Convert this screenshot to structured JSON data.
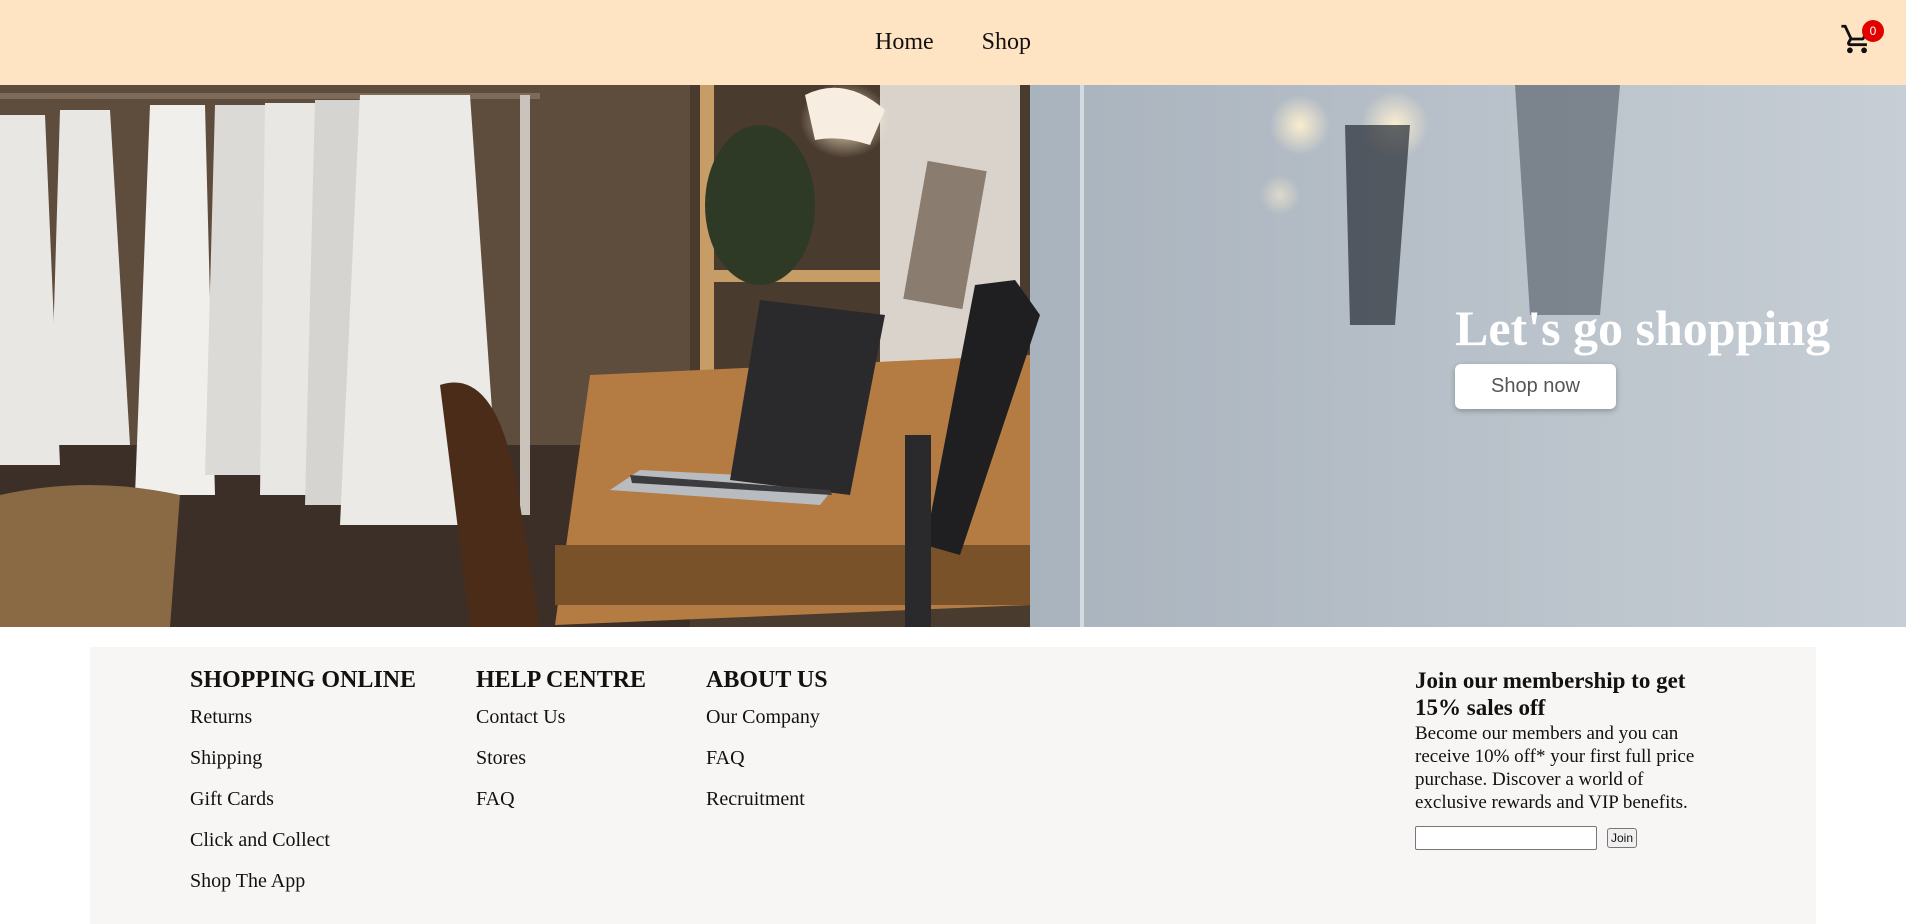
{
  "nav": {
    "links": [
      "Home",
      "Shop"
    ],
    "cart_icon": "shopping-cart-icon",
    "cart_count": "0"
  },
  "hero": {
    "title": "Let's go shopping",
    "button_label": "Shop now"
  },
  "footer": {
    "columns": [
      {
        "heading": "SHOPPING ONLINE",
        "links": [
          "Returns",
          "Shipping",
          "Gift Cards",
          "Click and Collect",
          "Shop The App"
        ]
      },
      {
        "heading": "HELP CENTRE",
        "links": [
          "Contact Us",
          "Stores",
          "FAQ"
        ]
      },
      {
        "heading": "ABOUT US",
        "links": [
          "Our Company",
          "FAQ",
          "Recruitment"
        ]
      }
    ],
    "membership": {
      "heading": "Join our membership to get 15% sales off",
      "text": "Become our members and you can receive 10% off* your first full price purchase. Discover a world of exclusive rewards and VIP benefits.",
      "input_value": "",
      "button_label": "Join"
    }
  },
  "colors": {
    "nav_background": "#ffe4c4",
    "badge": "#e10000",
    "footer_background": "#f8f6f4"
  }
}
